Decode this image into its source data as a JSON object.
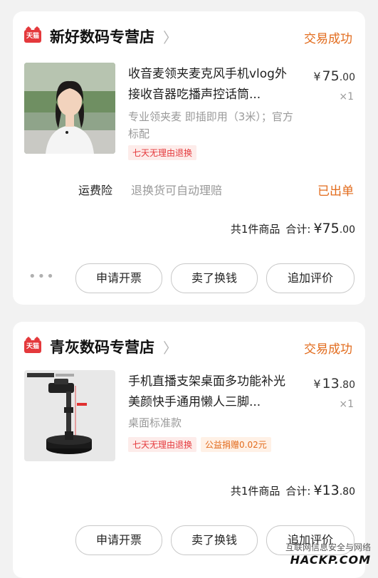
{
  "orders": [
    {
      "badge": "天猫",
      "shop_name": "新好数码专营店",
      "status": "交易成功",
      "product": {
        "title": "收音麦领夹麦克风手机vlog外接收音器吃播声控话筒...",
        "price_symbol": "¥",
        "price_int": "75",
        "price_dec": ".00",
        "quantity": "×1",
        "sku": "专业领夹麦 即插即用（3米）；官方标配",
        "tags": [
          "七天无理由退换"
        ]
      },
      "insurance": {
        "label": "运费险",
        "desc": "退换货可自动理赔",
        "status": "已出单"
      },
      "total": {
        "count_text": "共1件商品",
        "sum_label": "合计:",
        "symbol": "¥",
        "int": "75",
        "dec": ".00"
      },
      "more": "•••",
      "buttons": [
        "申请开票",
        "卖了换钱",
        "追加评价"
      ]
    },
    {
      "badge": "天猫",
      "shop_name": "青灰数码专营店",
      "status": "交易成功",
      "product": {
        "title": "手机直播支架桌面多功能补光美颜快手通用懒人三脚...",
        "price_symbol": "¥",
        "price_int": "13",
        "price_dec": ".80",
        "quantity": "×1",
        "sku": "桌面标准款",
        "tags": [
          "七天无理由退换",
          "公益捐赠0.02元"
        ]
      },
      "total": {
        "count_text": "共1件商品",
        "sum_label": "合计:",
        "symbol": "¥",
        "int": "13",
        "dec": ".80"
      },
      "buttons": [
        "申请开票",
        "卖了换钱",
        "追加评价"
      ]
    }
  ],
  "watermark": {
    "line1": "互联网信息安全与网络",
    "line2": "HACKP.COM"
  },
  "colors": {
    "accent_orange": "#e26b1c",
    "tmall_red": "#e4393c",
    "background": "#f2f2f2"
  }
}
